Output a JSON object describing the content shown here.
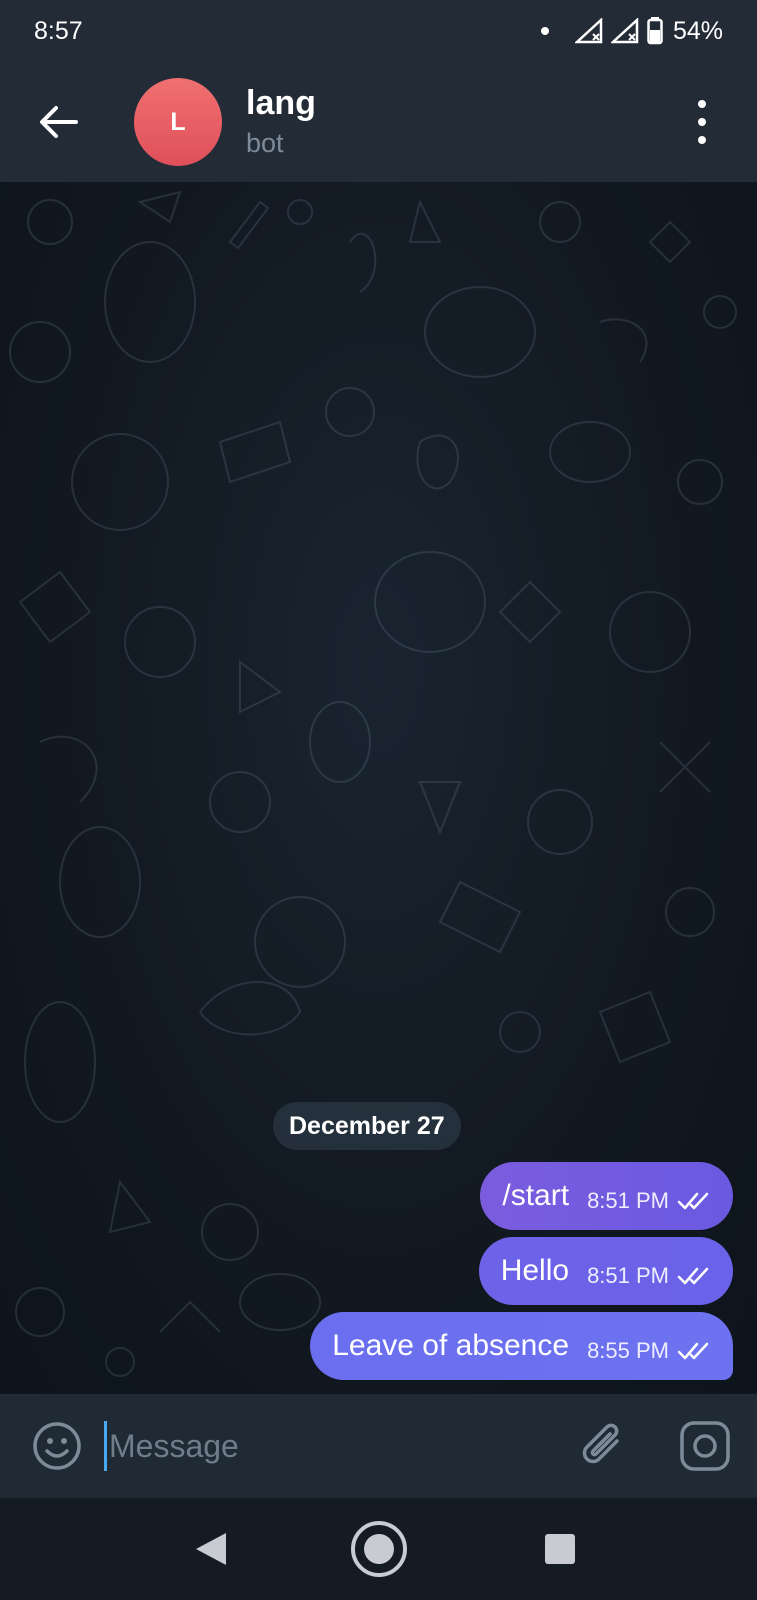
{
  "status_bar": {
    "time": "8:57",
    "battery": "54%",
    "icons": [
      "notification-dot-icon",
      "signal-icon",
      "signal-icon",
      "battery-icon"
    ]
  },
  "header": {
    "avatar_letter": "L",
    "title": "lang",
    "subtitle": "bot",
    "avatar_color": "#e85a60",
    "icons": [
      "back-arrow-icon",
      "more-vert-icon"
    ]
  },
  "chat": {
    "date_label": "December 27",
    "messages": [
      {
        "text": "/start",
        "time": "8:51 PM",
        "status": "read"
      },
      {
        "text": "Hello",
        "time": "8:51 PM",
        "status": "read"
      },
      {
        "text": "Leave of absence",
        "time": "8:55 PM",
        "status": "read"
      }
    ],
    "bubble_colors": [
      "#7b5cdf",
      "#6a62e8",
      "#6c72f0"
    ]
  },
  "composer": {
    "placeholder": "Message",
    "icons": [
      "emoji-icon",
      "attach-icon",
      "camera-icon"
    ]
  },
  "nav_bar": {
    "icons": [
      "nav-back-icon",
      "nav-home-icon",
      "nav-recent-icon"
    ]
  }
}
